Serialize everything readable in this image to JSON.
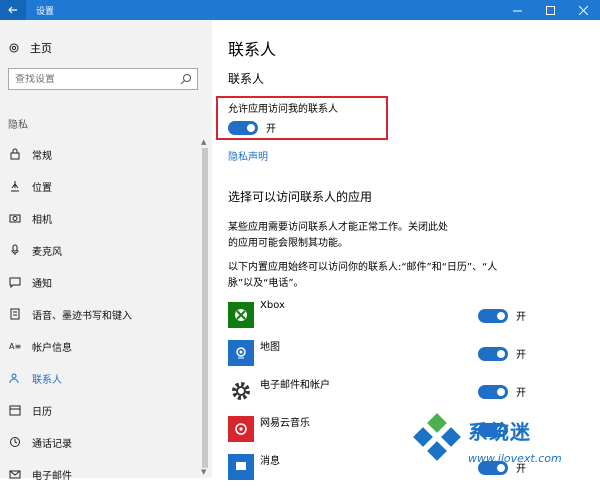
{
  "window": {
    "title": "设置",
    "back_icon": "back-arrow-icon",
    "controls": [
      "minimize-icon",
      "maximize-icon",
      "close-icon"
    ]
  },
  "sidebar": {
    "home_label": "主页",
    "search": {
      "placeholder": "查找设置",
      "value": ""
    },
    "section_label": "隐私",
    "items": [
      {
        "label": "常规",
        "icon": "lock-icon"
      },
      {
        "label": "位置",
        "icon": "location-icon"
      },
      {
        "label": "相机",
        "icon": "camera-icon"
      },
      {
        "label": "麦克风",
        "icon": "microphone-icon"
      },
      {
        "label": "通知",
        "icon": "notification-icon"
      },
      {
        "label": "语音、墨迹书写和键入",
        "icon": "speech-icon"
      },
      {
        "label": "帐户信息",
        "icon": "account-info-icon"
      },
      {
        "label": "联系人",
        "icon": "contacts-icon",
        "active": true
      },
      {
        "label": "日历",
        "icon": "calendar-icon"
      },
      {
        "label": "通话记录",
        "icon": "call-history-icon"
      },
      {
        "label": "电子邮件",
        "icon": "email-icon"
      }
    ]
  },
  "main": {
    "page_title": "联系人",
    "section_title": "联系人",
    "allow_label": "允许应用访问我的联系人",
    "allow_state": "开",
    "privacy_link": "隐私声明",
    "apps_title": "选择可以访问联系人的应用",
    "desc1": "某些应用需要访问联系人才能正常工作。关闭此处的应用可能会限制其功能。",
    "desc2": "以下内置应用始终可以访问你的联系人:“邮件”和“日历”、“人脉”以及“电话”。",
    "apps": [
      {
        "name": "Xbox",
        "state": "开",
        "icon": "xbox-icon"
      },
      {
        "name": "地图",
        "state": "开",
        "icon": "maps-icon"
      },
      {
        "name": "电子邮件和帐户",
        "state": "开",
        "icon": "gear-icon"
      },
      {
        "name": "网易云音乐",
        "state": "开",
        "icon": "netease-music-icon"
      },
      {
        "name": "消息",
        "state": "开",
        "icon": "messaging-icon"
      }
    ]
  },
  "watermark": {
    "title": "系统迷",
    "url": "www.ilovext.com"
  },
  "colors": {
    "accent": "#1f6fc6",
    "titlebar": "#1f78d1",
    "highlight": "#d9232e"
  }
}
